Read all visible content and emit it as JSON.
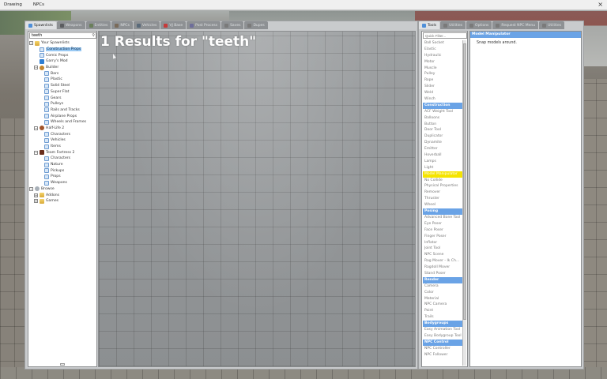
{
  "menubar": {
    "items": [
      "Drawing",
      "NPCs"
    ],
    "close": "×"
  },
  "spawn_tabs": [
    {
      "label": "Spawnlists",
      "active": true,
      "color": "#4f8fd8"
    },
    {
      "label": "Weapons",
      "active": false,
      "color": "#5b5d60"
    },
    {
      "label": "Entities",
      "active": false,
      "color": "#6a7f5b"
    },
    {
      "label": "NPCs",
      "active": false,
      "color": "#7a6b5a"
    },
    {
      "label": "Vehicles",
      "active": false,
      "color": "#5a6a7a"
    },
    {
      "label": "VJ Base",
      "active": false,
      "color": "#c63a3a"
    },
    {
      "label": "Post Process",
      "active": false,
      "color": "#6e6e9a"
    },
    {
      "label": "Saves",
      "active": false,
      "color": "#7a7a7a"
    },
    {
      "label": "Dupes",
      "active": false,
      "color": "#7a7a7a"
    }
  ],
  "search": {
    "value": "teeth",
    "icon": "search-icon"
  },
  "tree": [
    {
      "label": "Your Spawnlists",
      "indent": 0,
      "expander": "−",
      "icon": "folder"
    },
    {
      "label": "Construction Props",
      "indent": 1,
      "expander": "",
      "icon": "page",
      "selected": true
    },
    {
      "label": "Comic Props",
      "indent": 1,
      "expander": "",
      "icon": "page"
    },
    {
      "label": "Garry's Mod",
      "indent": 1,
      "expander": "",
      "icon": "gmod"
    },
    {
      "label": "Builder",
      "indent": 1,
      "expander": "−",
      "icon": "wrench"
    },
    {
      "label": "Bars",
      "indent": 2,
      "expander": "",
      "icon": "page"
    },
    {
      "label": "Plastic",
      "indent": 2,
      "expander": "",
      "icon": "page"
    },
    {
      "label": "Solid Steel",
      "indent": 2,
      "expander": "",
      "icon": "page"
    },
    {
      "label": "Super Flat",
      "indent": 2,
      "expander": "",
      "icon": "page"
    },
    {
      "label": "Gears",
      "indent": 2,
      "expander": "",
      "icon": "page"
    },
    {
      "label": "Pulleys",
      "indent": 2,
      "expander": "",
      "icon": "page"
    },
    {
      "label": "Rails and Tracks",
      "indent": 2,
      "expander": "",
      "icon": "page"
    },
    {
      "label": "Airplane Props",
      "indent": 2,
      "expander": "",
      "icon": "page"
    },
    {
      "label": "Wheels and Frames",
      "indent": 2,
      "expander": "",
      "icon": "page"
    },
    {
      "label": "Half-Life 2",
      "indent": 1,
      "expander": "−",
      "icon": "hl2"
    },
    {
      "label": "Characters",
      "indent": 2,
      "expander": "",
      "icon": "page"
    },
    {
      "label": "Vehicles",
      "indent": 2,
      "expander": "",
      "icon": "page"
    },
    {
      "label": "Items",
      "indent": 2,
      "expander": "",
      "icon": "page"
    },
    {
      "label": "Team Fortress 2",
      "indent": 1,
      "expander": "−",
      "icon": "tf2"
    },
    {
      "label": "Characters",
      "indent": 2,
      "expander": "",
      "icon": "page"
    },
    {
      "label": "Nature",
      "indent": 2,
      "expander": "",
      "icon": "page"
    },
    {
      "label": "Pickups",
      "indent": 2,
      "expander": "",
      "icon": "page"
    },
    {
      "label": "Props",
      "indent": 2,
      "expander": "",
      "icon": "page"
    },
    {
      "label": "Weapons",
      "indent": 2,
      "expander": "",
      "icon": "page"
    },
    {
      "label": "Browse",
      "indent": 0,
      "expander": "−",
      "icon": "globe"
    },
    {
      "label": "Addons",
      "indent": 1,
      "expander": "+",
      "icon": "folder"
    },
    {
      "label": "Games",
      "indent": 1,
      "expander": "+",
      "icon": "folder"
    }
  ],
  "results": {
    "title": "1 Results for \"teeth\""
  },
  "tool_tabs": [
    {
      "label": "Tools",
      "active": true,
      "color": "#4f8fd8"
    },
    {
      "label": "Utilities",
      "active": false,
      "color": "#7a7a7a"
    },
    {
      "label": "Options",
      "active": false,
      "color": "#7a7a7a"
    },
    {
      "label": "Request NPC Menu",
      "active": false,
      "color": "#7a7a7a"
    },
    {
      "label": "Utilities",
      "active": false,
      "color": "#7a7a7a"
    }
  ],
  "quick_filter": {
    "placeholder": "Quick Filter..."
  },
  "tool_list": [
    {
      "label": "Ball Socket",
      "type": "item"
    },
    {
      "label": "Elastic",
      "type": "item"
    },
    {
      "label": "Hydraulic",
      "type": "item"
    },
    {
      "label": "Motor",
      "type": "item"
    },
    {
      "label": "Muscle",
      "type": "item"
    },
    {
      "label": "Pulley",
      "type": "item"
    },
    {
      "label": "Rope",
      "type": "item"
    },
    {
      "label": "Slider",
      "type": "item"
    },
    {
      "label": "Weld",
      "type": "item"
    },
    {
      "label": "Winch",
      "type": "item"
    },
    {
      "label": "Construction",
      "type": "cat"
    },
    {
      "label": "ACF Weight Tool",
      "type": "item"
    },
    {
      "label": "Balloons",
      "type": "item"
    },
    {
      "label": "Button",
      "type": "item"
    },
    {
      "label": "Door Tool",
      "type": "item"
    },
    {
      "label": "Duplicator",
      "type": "item"
    },
    {
      "label": "Dynamite",
      "type": "item"
    },
    {
      "label": "Emitter",
      "type": "item"
    },
    {
      "label": "Hoverball",
      "type": "item"
    },
    {
      "label": "Lamps",
      "type": "item"
    },
    {
      "label": "Light",
      "type": "item"
    },
    {
      "label": "Model Manipulator",
      "type": "hl"
    },
    {
      "label": "No Collide",
      "type": "item"
    },
    {
      "label": "Physical Properties",
      "type": "item"
    },
    {
      "label": "Remover",
      "type": "item"
    },
    {
      "label": "Thruster",
      "type": "item"
    },
    {
      "label": "Wheel",
      "type": "item"
    },
    {
      "label": "Posing",
      "type": "cat"
    },
    {
      "label": "Advanced Bone Tool",
      "type": "item"
    },
    {
      "label": "Eye Poser",
      "type": "item"
    },
    {
      "label": "Face Poser",
      "type": "item"
    },
    {
      "label": "Finger Poser",
      "type": "item"
    },
    {
      "label": "Inflator",
      "type": "item"
    },
    {
      "label": "Joint Tool",
      "type": "item"
    },
    {
      "label": "NPC Scene",
      "type": "item"
    },
    {
      "label": "Rag Mover - Ik Ch...",
      "type": "item"
    },
    {
      "label": "Ragdoll Mover",
      "type": "item"
    },
    {
      "label": "Stand Poser",
      "type": "item"
    },
    {
      "label": "Render",
      "type": "cat"
    },
    {
      "label": "Camera",
      "type": "item"
    },
    {
      "label": "Color",
      "type": "item"
    },
    {
      "label": "Material",
      "type": "item"
    },
    {
      "label": "NPC Camera",
      "type": "item"
    },
    {
      "label": "Paint",
      "type": "item"
    },
    {
      "label": "Trails",
      "type": "item"
    },
    {
      "label": "Bodygroups",
      "type": "cat"
    },
    {
      "label": "Easy Animation Tool",
      "type": "item"
    },
    {
      "label": "Easy Bodygroup Tool",
      "type": "item"
    },
    {
      "label": "NPC Control",
      "type": "cat"
    },
    {
      "label": "NPC Controller",
      "type": "item"
    },
    {
      "label": "NPC Follower",
      "type": "item"
    }
  ],
  "properties": {
    "header": "Model Manipulator",
    "description": "Snap models around."
  },
  "colors": {
    "category_blue": "#6aa3e6",
    "highlight_yellow": "#f5e400",
    "selected_blue": "#99c9f3"
  }
}
